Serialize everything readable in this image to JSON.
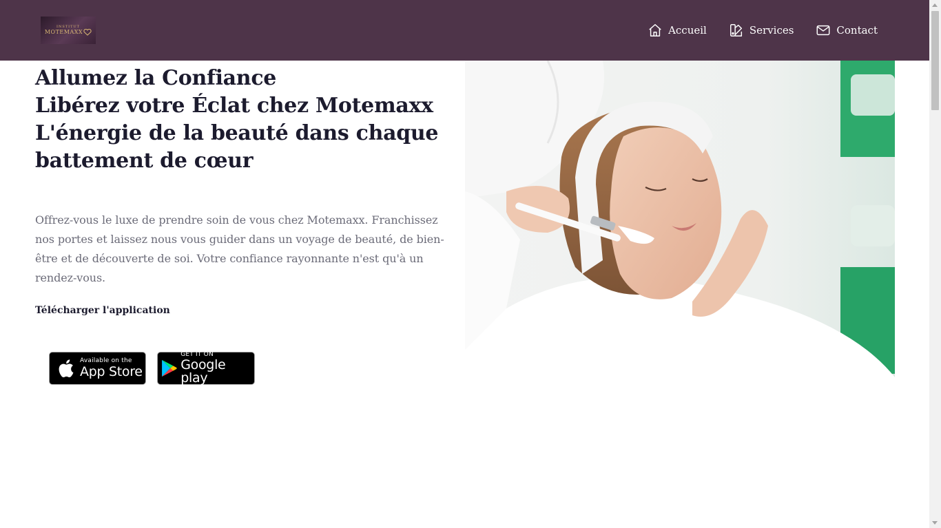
{
  "header": {
    "logo": {
      "line1": "INSTITUT",
      "line2": "MOTEMAXX"
    },
    "nav": [
      {
        "label": "Accueil",
        "icon": "home-icon"
      },
      {
        "label": "Services",
        "icon": "swatch-icon"
      },
      {
        "label": "Contact",
        "icon": "envelope-icon"
      }
    ]
  },
  "hero": {
    "title_lines": [
      "Allumez la Confiance",
      "Libérez votre Éclat chez Motemaxx",
      "L'énergie de la beauté dans chaque",
      "battement de cœur"
    ],
    "description": "Offrez-vous le luxe de prendre soin de vous chez Motemaxx. Franchissez nos portes et laissez nous vous guider dans un voyage de beauté, de bien-être et de découverte de soi. Votre confiance rayonnante n'est qu'à un rendez-vous.",
    "download_label": "Télécharger l'application",
    "app_store": {
      "small": "Available on the",
      "big": "App Store",
      "icon": "apple-icon"
    },
    "google_play": {
      "small": "GET IT ON",
      "big": "Google play",
      "icon": "google-play-icon"
    }
  },
  "colors": {
    "header_bg": "#4e3449",
    "title": "#1c1b2e",
    "body_text": "#6b6b78",
    "logo_gold": "#d9b774"
  }
}
